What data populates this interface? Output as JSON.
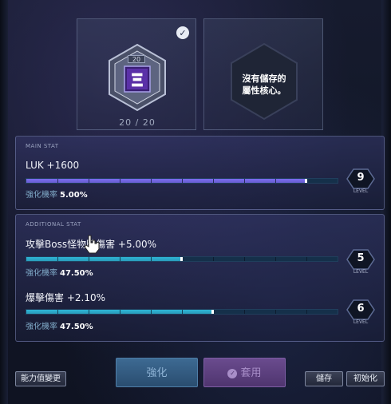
{
  "core": {
    "level_tag": "20",
    "glyph": "𝚵",
    "count_current": "20",
    "count_separator": "/",
    "count_max": "20",
    "checked": true
  },
  "empty_slot": {
    "message": "沒有儲存的\n屬性核心。"
  },
  "main_stat": {
    "header": "MAIN STAT",
    "stat": "LUK +1600",
    "chance_label": "強化機率",
    "chance_value": "5.00%",
    "progress": 0.9,
    "level": "9",
    "level_word": "LEVEL",
    "bar_color": "#7b6bf0"
  },
  "additional_stat": {
    "header": "ADDITIONAL STAT",
    "items": [
      {
        "stat": "攻擊Boss怪物時傷害 +5.00%",
        "chance_label": "強化機率",
        "chance_value": "47.50%",
        "progress": 0.5,
        "level": "5",
        "level_word": "LEVEL"
      },
      {
        "stat": "爆擊傷害 +2.10%",
        "chance_label": "強化機率",
        "chance_value": "47.50%",
        "progress": 0.6,
        "level": "6",
        "level_word": "LEVEL"
      }
    ],
    "bar_color": "#2fb6d6"
  },
  "buttons": {
    "change_ability": "能力值變更",
    "enhance": "強化",
    "apply": "套用",
    "save": "儲存",
    "reset": "初始化"
  }
}
